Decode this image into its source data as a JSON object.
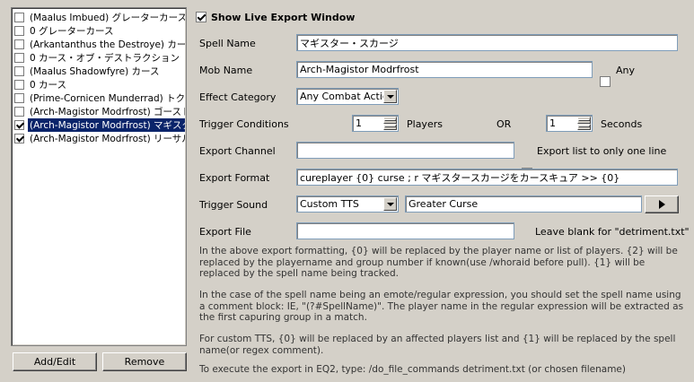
{
  "list": {
    "items": [
      {
        "label": "(Maalus Imbued) グレーターカース",
        "checked": false,
        "selected": false
      },
      {
        "label": "0 グレーターカース",
        "checked": false,
        "selected": false
      },
      {
        "label": "(Arkantanthus the Destroye) カース・オブ・デストラクション",
        "checked": false,
        "selected": false
      },
      {
        "label": "0 カース・オブ・デストラクション",
        "checked": false,
        "selected": false
      },
      {
        "label": "(Maalus Shadowfyre) カース",
        "checked": false,
        "selected": false
      },
      {
        "label": "0 カース",
        "checked": false,
        "selected": false
      },
      {
        "label": "(Prime-Cornicen Munderrad) トクシック・カース",
        "checked": false,
        "selected": false
      },
      {
        "label": "(Arch-Magistor Modrfrost) ゴーストリー・カース",
        "checked": false,
        "selected": false
      },
      {
        "label": "(Arch-Magistor Modrfrost) マギスター・スカージ",
        "checked": true,
        "selected": true
      },
      {
        "label": "(Arch-Magistor Modrfrost) リーサル・カース",
        "checked": true,
        "selected": false
      }
    ]
  },
  "buttons": {
    "add_edit": "Add/Edit",
    "remove": "Remove",
    "play": "▷"
  },
  "show_live": {
    "label": "Show Live Export Window",
    "checked": true
  },
  "form": {
    "spell_name": {
      "label": "Spell Name",
      "value": "マギスター・スカージ"
    },
    "mob_name": {
      "label": "Mob Name",
      "value": "Arch-Magistor Modrfrost",
      "any_label": "Any",
      "any_checked": false
    },
    "effect_category": {
      "label": "Effect Category",
      "value": "Any Combat Actic"
    },
    "trigger_conditions": {
      "label": "Trigger Conditions",
      "players_value": "1",
      "players_label": "Players",
      "or_label": "OR",
      "seconds_value": "1",
      "seconds_label": "Seconds"
    },
    "export_channel": {
      "label": "Export Channel",
      "value": "",
      "only_one_label": "Export list to only one line",
      "only_one_checked": false
    },
    "export_format": {
      "label": "Export Format",
      "value": "cureplayer {0} curse ; r マギスタースカージをカースキュア >> {0}"
    },
    "trigger_sound": {
      "label": "Trigger Sound",
      "type_value": "Custom TTS",
      "tts_value": "Greater Curse"
    },
    "export_file": {
      "label": "Export File",
      "value": "",
      "hint": "Leave blank for \"detriment.txt\""
    }
  },
  "help": {
    "p1": "In the above export formatting, {0} will be replaced by the player name or list of players. {2} will be replaced by the playername and group number if known(use /whoraid before pull).  {1} will be replaced by the spell name being tracked.",
    "p2": "In the case of the spell name being an emote/regular expression, you should set the spell name using a comment block: IE, \"(?#SpellName)\".  The player name in the regular expression will be extracted as the first capuring group in a match.",
    "p3": "For custom TTS, {0} will be replaced by an affected players list and {1} will be replaced by the spell name(or regex comment).",
    "p4": "To execute the export in EQ2, type: /do_file_commands detriment.txt   (or chosen filename)"
  }
}
